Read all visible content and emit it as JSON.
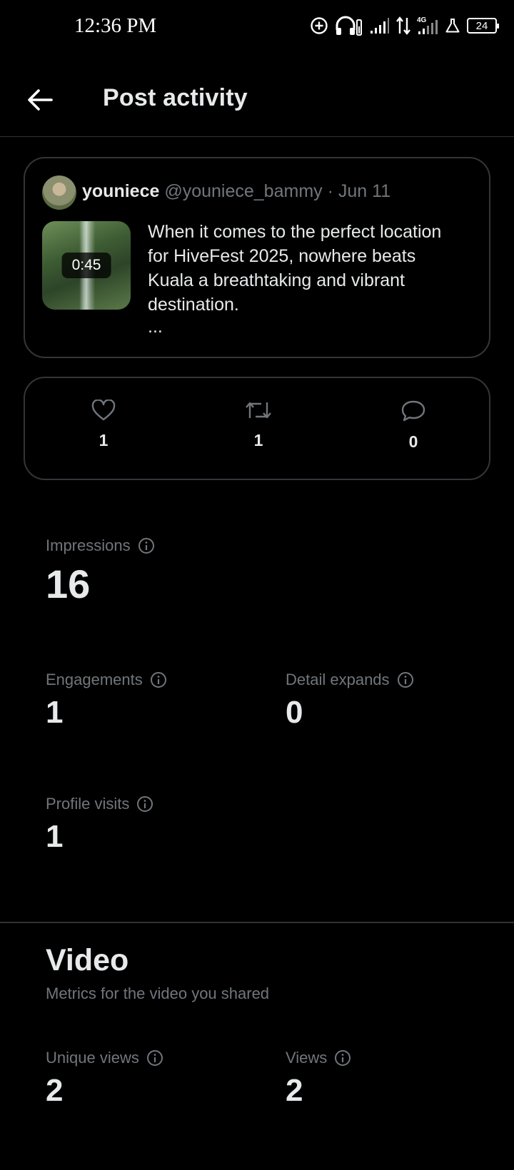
{
  "status_bar": {
    "time": "12:36 PM",
    "network": "4G",
    "battery": "24",
    "icons": [
      "add-circle-icon",
      "headphones-icon",
      "signal-icon",
      "data-arrows-icon",
      "signal-4g-icon",
      "alert-icon",
      "battery-icon"
    ]
  },
  "header": {
    "back_icon": "arrow-left-icon",
    "title": "Post activity"
  },
  "post": {
    "author_name": "youniece",
    "handle": "@youniece_bammy",
    "separator": "·",
    "date": "Jun 11",
    "video_duration": "0:45",
    "text": "When it comes to the perfect location for HiveFest 2025, nowhere beats Kuala a breathtaking and vibrant destination.",
    "ellipsis": "..."
  },
  "engagement": {
    "likes": "1",
    "reposts": "1",
    "replies": "0"
  },
  "metrics": {
    "impressions": {
      "label": "Impressions",
      "value": "16"
    },
    "engagements": {
      "label": "Engagements",
      "value": "1"
    },
    "detail_expands": {
      "label": "Detail expands",
      "value": "0"
    },
    "profile_visits": {
      "label": "Profile visits",
      "value": "1"
    }
  },
  "video": {
    "title": "Video",
    "subtitle": "Metrics for the video you shared",
    "unique_views": {
      "label": "Unique views",
      "value": "2"
    },
    "views": {
      "label": "Views",
      "value": "2"
    }
  },
  "colors": {
    "background": "#000000",
    "primary_text": "#e7e9ea",
    "secondary_text": "#71767b",
    "border": "#333639"
  }
}
